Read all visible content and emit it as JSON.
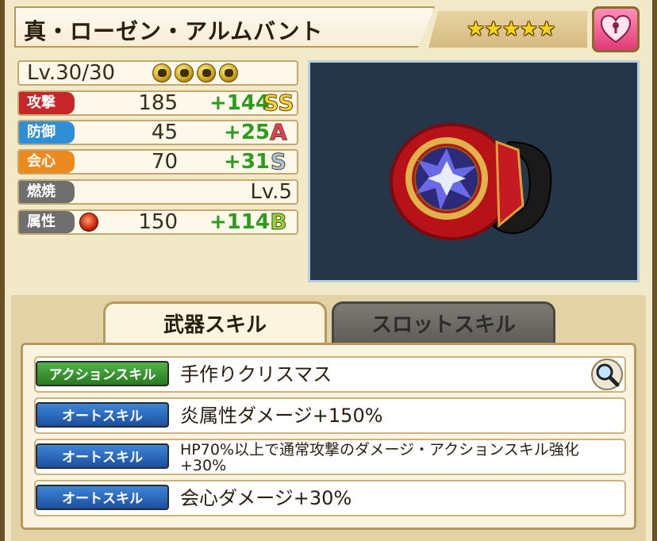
{
  "item": {
    "name": "真・ローゼン・アルムバント",
    "rarity_stars": "★★★★★",
    "image_alt": "red-jewel-ring"
  },
  "level": {
    "text": "Lv.30/30",
    "orbs": 4
  },
  "stats": [
    {
      "label": "攻撃",
      "color": "#c7262b",
      "base": "185",
      "bonus": "+144",
      "grade": "SS",
      "grade_color": "#f3d336"
    },
    {
      "label": "防御",
      "color": "#2f8fd6",
      "base": "45",
      "bonus": "+25",
      "grade": "A",
      "grade_color": "#e83d63"
    },
    {
      "label": "会心",
      "color": "#ec8a1f",
      "base": "70",
      "bonus": "+31",
      "grade": "S",
      "grade_color": "#a9c4e8"
    },
    {
      "label": "燃焼",
      "color": "#6f6f6f",
      "burn_level": "Lv.5"
    },
    {
      "label": "属性",
      "color": "#6f6f6f",
      "base": "150",
      "bonus": "+114",
      "grade": "B",
      "grade_color": "#8fd63a",
      "element_icon": "fire-element-icon"
    }
  ],
  "tabs": {
    "weapon": "武器スキル",
    "slot": "スロットスキル"
  },
  "skills": [
    {
      "badge": "アクションスキル",
      "type": "action",
      "text": "手作りクリスマス"
    },
    {
      "badge": "オートスキル",
      "type": "auto",
      "text": "炎属性ダメージ+150%"
    },
    {
      "badge": "オートスキル",
      "type": "auto",
      "text": "HP70%以上で通常攻撃のダメージ・アクションスキル強化+30%"
    },
    {
      "badge": "オートスキル",
      "type": "auto",
      "text": "会心ダメージ+30%"
    }
  ]
}
